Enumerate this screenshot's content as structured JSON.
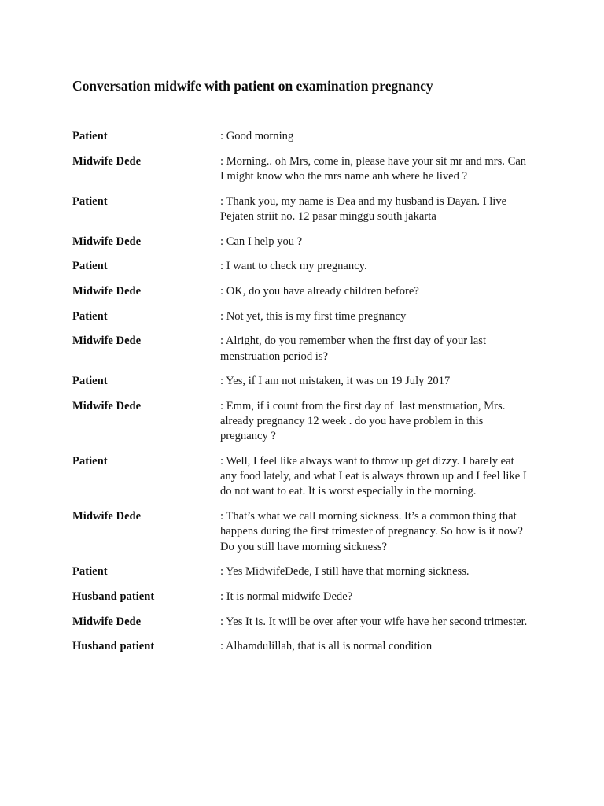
{
  "document": {
    "title": "Conversation midwife with patient on examination pregnancy",
    "background_color": "#ffffff",
    "text_color": "#131313"
  },
  "transcript": {
    "rows": [
      {
        "speaker": "Patient",
        "text": ": Good morning"
      },
      {
        "speaker": "Midwife Dede",
        "text": ": Morning.. oh Mrs, come in, please have your sit mr and mrs. Can I might know who the mrs name anh where he lived ?"
      },
      {
        "speaker": "Patient",
        "text": ": Thank you, my name is Dea and my husband is Dayan. I live Pejaten striit no. 12 pasar minggu south jakarta"
      },
      {
        "speaker": "Midwife Dede",
        "text": ": Can I help you ?"
      },
      {
        "speaker": "Patient",
        "text": ": I want to check my pregnancy."
      },
      {
        "speaker": "Midwife Dede",
        "text": ": OK, do you have already children before?"
      },
      {
        "speaker": "Patient",
        "text": ": Not yet, this is my first time pregnancy"
      },
      {
        "speaker": "Midwife Dede",
        "text": ": Alright, do you remember when the first day of your last menstruation period is?"
      },
      {
        "speaker": "Patient",
        "text": ": Yes, if I am not mistaken, it was on 19 July 2017"
      },
      {
        "speaker": "Midwife Dede",
        "text": ": Emm, if i count from the first day of  last menstruation, Mrs. already pregnancy 12 week . do you have problem in this pregnancy ?"
      },
      {
        "speaker": "Patient",
        "text": ": Well, I feel like always want to throw up get dizzy. I barely eat any food lately, and what I eat is always thrown up and I feel like I do not want to eat. It is worst especially in the morning."
      },
      {
        "speaker": "Midwife Dede",
        "text": ": That’s what we call morning sickness. It’s a common thing that happens during the first trimester of pregnancy. So how is it now? Do you still have morning sickness?"
      },
      {
        "speaker": "Patient",
        "text": ": Yes MidwifeDede, I still have that morning sickness."
      },
      {
        "speaker": "Husband patient",
        "text": ": It is normal midwife Dede?"
      },
      {
        "speaker": "Midwife Dede",
        "text": ": Yes It is. It will be over after your wife have her second trimester."
      },
      {
        "speaker": "Husband patient",
        "text": ": Alhamdulillah, that is all is normal condition"
      }
    ]
  }
}
